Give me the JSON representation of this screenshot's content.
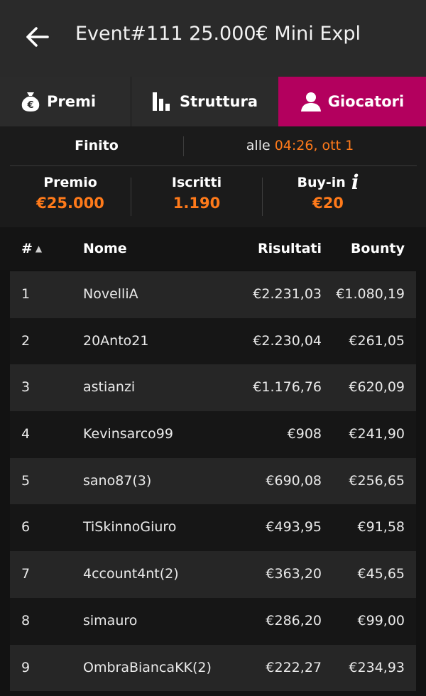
{
  "header": {
    "title": "Event#111 25.000€ Mini Expl"
  },
  "tabs": [
    {
      "label": "Premi",
      "icon": "money-bag-euro-icon",
      "active": false
    },
    {
      "label": "Struttura",
      "icon": "bar-chart-icon",
      "active": false
    },
    {
      "label": "Giocatori",
      "icon": "person-icon",
      "active": true
    }
  ],
  "status": {
    "state": "Finito",
    "time_prefix": "alle",
    "time_value": "04:26, ott 1"
  },
  "stats": {
    "premio_label": "Premio",
    "premio_value": "€25.000",
    "iscritti_label": "Iscritti",
    "iscritti_value": "1.190",
    "buyin_label": "Buy-in",
    "buyin_value": "€20",
    "info_symbol": "i"
  },
  "table": {
    "headers": {
      "rank": "#",
      "name": "Nome",
      "results": "Risultati",
      "bounty": "Bounty"
    },
    "sort_indicator": "▲",
    "rows": [
      {
        "rank": "1",
        "name": "NovelliA",
        "results": "€2.231,03",
        "bounty": "€1.080,19"
      },
      {
        "rank": "2",
        "name": "20Anto21",
        "results": "€2.230,04",
        "bounty": "€261,05"
      },
      {
        "rank": "3",
        "name": "astianzi",
        "results": "€1.176,76",
        "bounty": "€620,09"
      },
      {
        "rank": "4",
        "name": "Kevinsarco99",
        "results": "€908",
        "bounty": "€241,90"
      },
      {
        "rank": "5",
        "name": "sano87(3)",
        "results": "€690,08",
        "bounty": "€256,65"
      },
      {
        "rank": "6",
        "name": "TiSkinnoGiuro",
        "results": "€493,95",
        "bounty": "€91,58"
      },
      {
        "rank": "7",
        "name": "4ccount4nt(2)",
        "results": "€363,20",
        "bounty": "€45,65"
      },
      {
        "rank": "8",
        "name": "simauro",
        "results": "€286,20",
        "bounty": "€99,00"
      },
      {
        "rank": "9",
        "name": "OmbraBiancaKK(2)",
        "results": "€222,27",
        "bounty": "€234,93"
      }
    ]
  },
  "colors": {
    "accent": "#b3005e",
    "highlight": "#ff7a1a",
    "header_bg": "#2a2a2a"
  }
}
